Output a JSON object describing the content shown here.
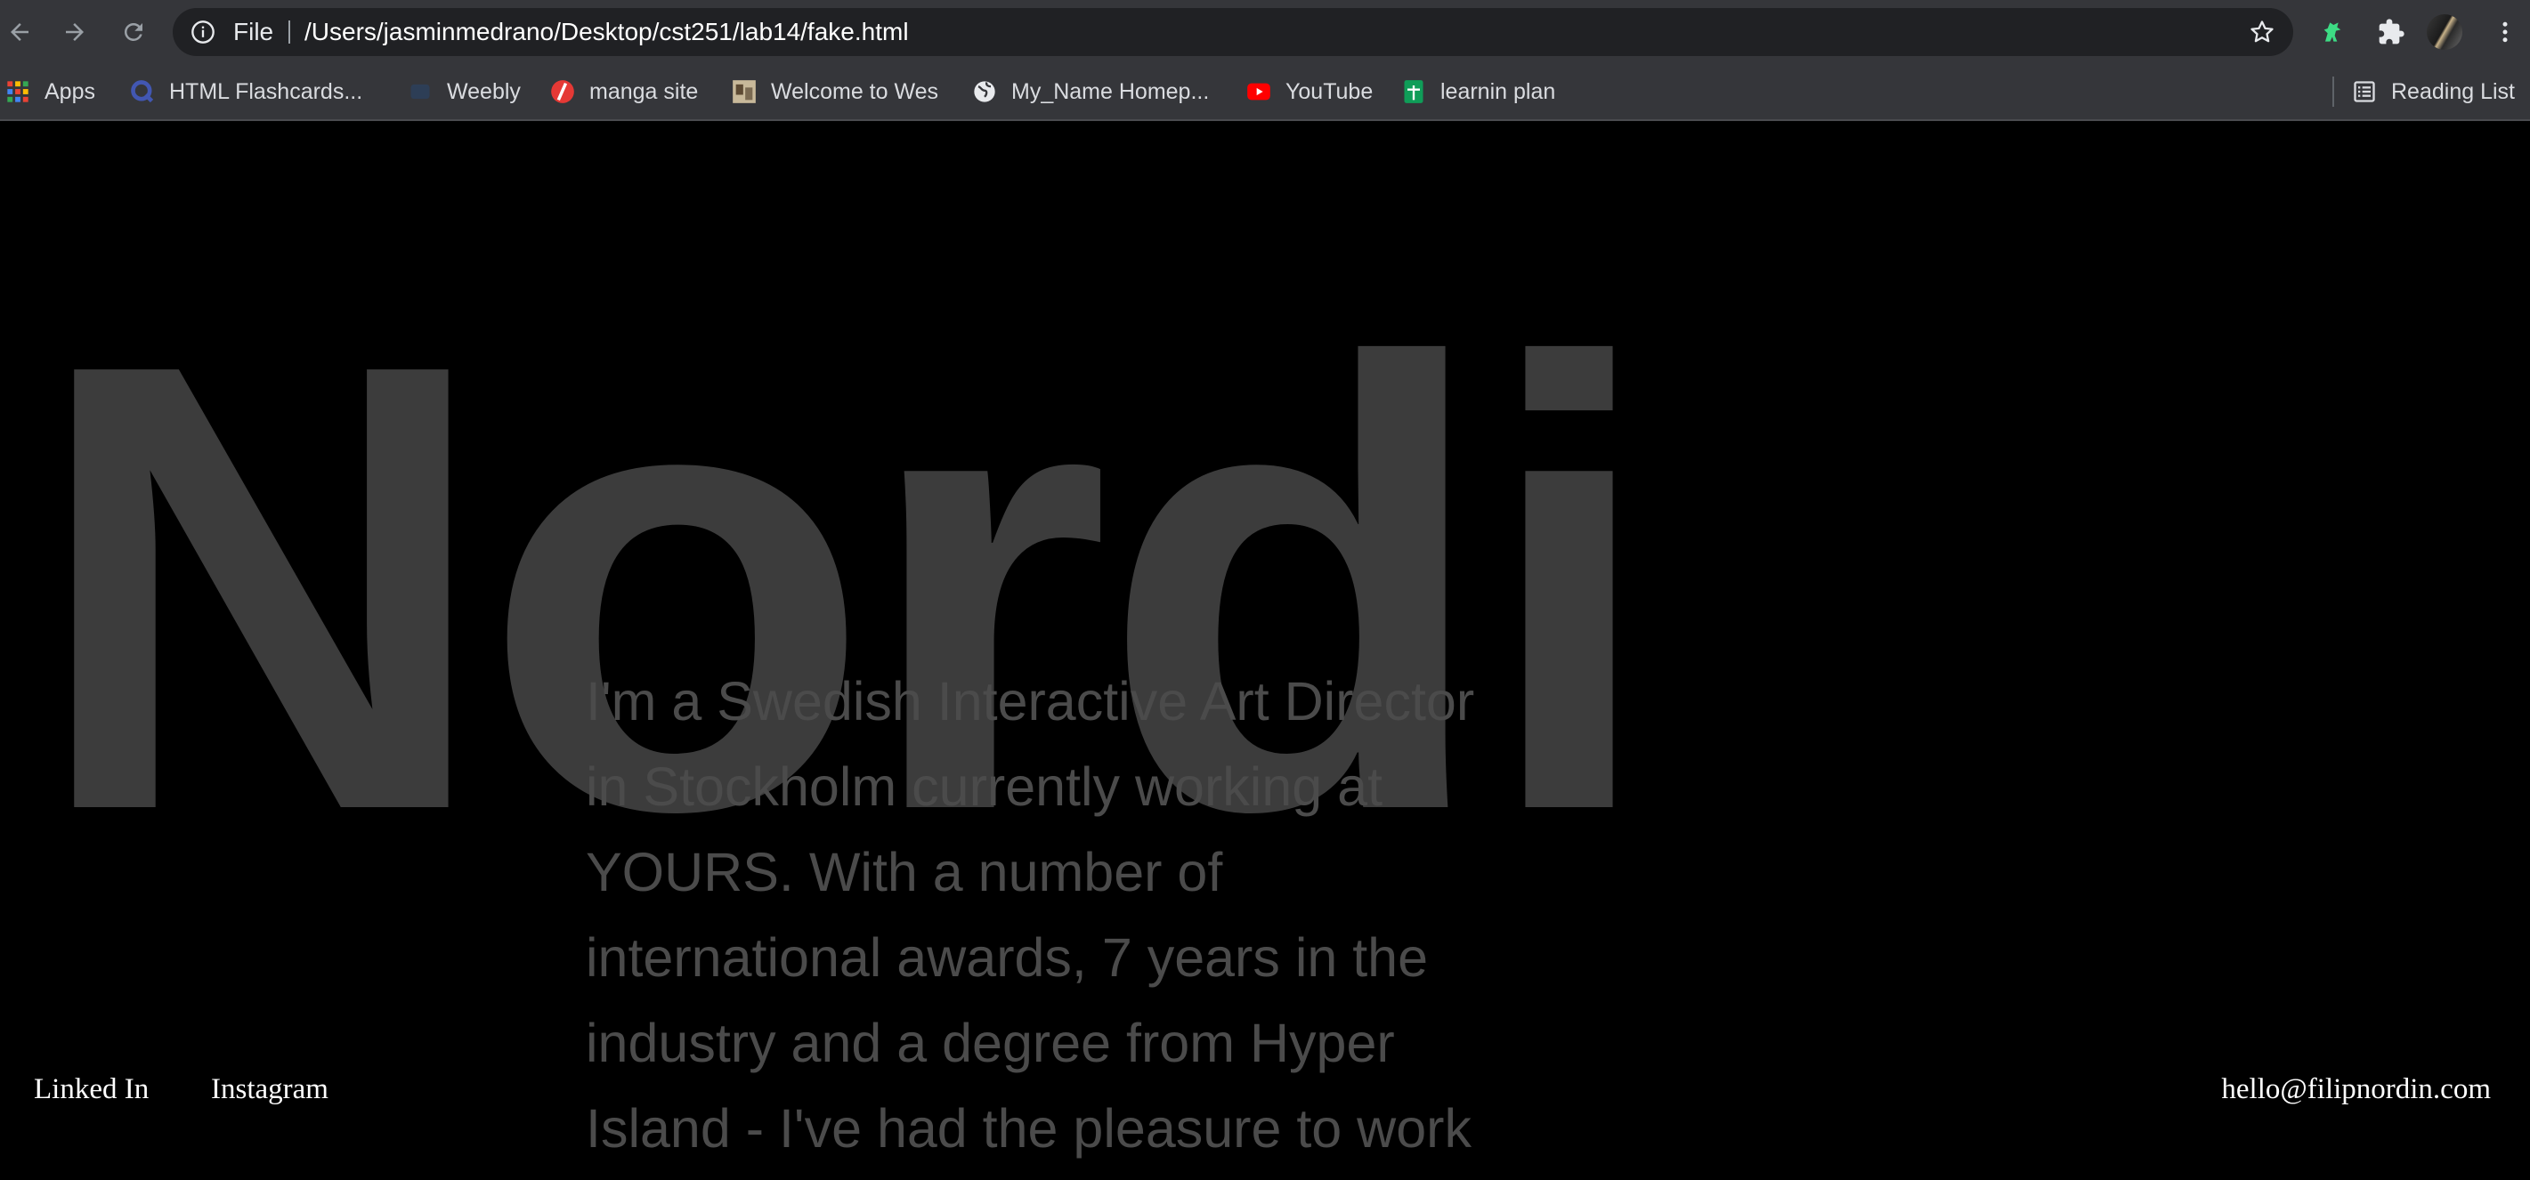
{
  "browser": {
    "scheme_label": "File",
    "url": "/Users/jasminmedrano/Desktop/cst251/lab14/fake.html",
    "bookmarks": [
      {
        "label": "Apps",
        "icon": "apps-grid-icon"
      },
      {
        "label": "HTML Flashcards...",
        "icon": "quizlet-icon"
      },
      {
        "label": "Weebly",
        "icon": "weebly-icon"
      },
      {
        "label": "manga site",
        "icon": "manga-site-icon"
      },
      {
        "label": "Welcome to Wes",
        "icon": "site-thumbnail-icon"
      },
      {
        "label": "My_Name Homep...",
        "icon": "globe-icon"
      },
      {
        "label": "YouTube",
        "icon": "youtube-icon"
      },
      {
        "label": "learnin plan",
        "icon": "sheets-icon"
      }
    ],
    "reading_list_label": "Reading List",
    "colors": {
      "toolbar": "#35363a",
      "omnibox": "#202124"
    }
  },
  "page": {
    "hero_text": "o Nordi",
    "bio_text": "I'm a Swedish Interactive Art Director in Stockholm currently working at YOURS. With a number of international awards, 7 years in the industry and a degree from Hyper Island - I've had the pleasure to work",
    "links": {
      "linkedin": "Linked In",
      "instagram": "Instagram",
      "email": "hello@filipnordin.com"
    },
    "colors": {
      "background": "#000000",
      "hero": "#3c3c3c",
      "bio": "#4b4b4b",
      "links": "#ffffff"
    }
  }
}
